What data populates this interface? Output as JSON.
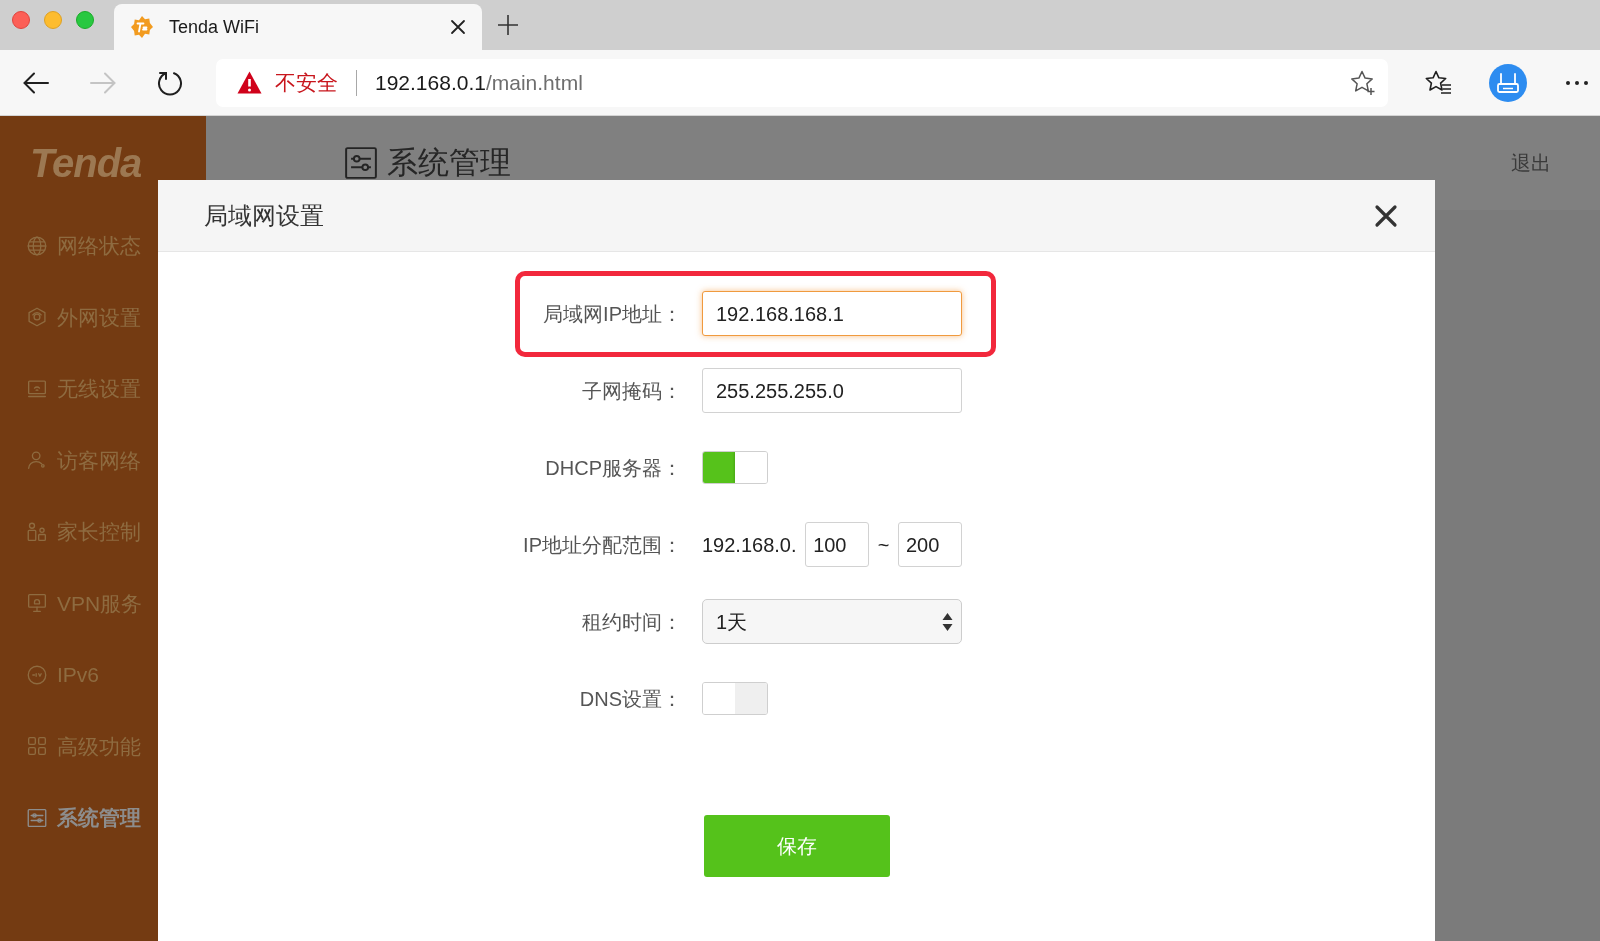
{
  "browser": {
    "tabs": [
      {
        "title": "Tenda WiFi",
        "selected": true
      }
    ],
    "nav_buttons": [
      {
        "kind": "back",
        "disabled": false
      },
      {
        "kind": "forward",
        "disabled": true
      },
      {
        "kind": "reload",
        "disabled": false
      }
    ],
    "address_bar": {
      "security_label": "不安全",
      "host": "192.168.0.1",
      "path": "/main.html"
    }
  },
  "sidebar": {
    "logo": "Tenda",
    "items": [
      {
        "label": "网络状态",
        "selected": false
      },
      {
        "label": "外网设置",
        "selected": false
      },
      {
        "label": "无线设置",
        "selected": false
      },
      {
        "label": "访客网络",
        "selected": false
      },
      {
        "label": "家长控制",
        "selected": false
      },
      {
        "label": "VPN服务",
        "selected": false
      },
      {
        "label": "IPv6",
        "selected": false
      },
      {
        "label": "高级功能",
        "selected": false
      },
      {
        "label": "系统管理",
        "selected": true
      }
    ]
  },
  "header": {
    "title": "系统管理",
    "logout": "退出"
  },
  "dialog": {
    "title": "局域网设置",
    "fields": [
      {
        "kind": "text",
        "label": "局域网IP地址：",
        "value": "192.168.168.1",
        "focused": true,
        "highlighted": true
      },
      {
        "kind": "text",
        "label": "子网掩码：",
        "value": "255.255.255.0",
        "focused": false,
        "highlighted": false
      },
      {
        "kind": "toggle",
        "label": "DHCP服务器：",
        "on": true,
        "highlighted": false
      },
      {
        "kind": "range",
        "label": "IP地址分配范围：",
        "prefix": "192.168.0.",
        "start": "100",
        "separator": "~",
        "end": "200",
        "highlighted": false
      },
      {
        "kind": "select",
        "label": "租约时间：",
        "value": "1天",
        "highlighted": false
      },
      {
        "kind": "toggle",
        "label": "DNS设置：",
        "on": false,
        "highlighted": false
      }
    ],
    "save_button": "保存"
  }
}
